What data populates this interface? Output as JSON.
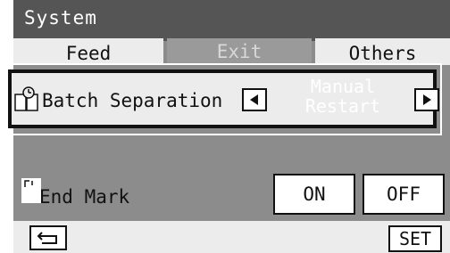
{
  "header": {
    "title": "System"
  },
  "tabs": [
    {
      "label": "Feed"
    },
    {
      "label": "Exit"
    },
    {
      "label": "Others"
    }
  ],
  "batch_separation": {
    "label": "Batch Separation",
    "mode_line1": "Manual",
    "mode_line2": "Restart"
  },
  "end_mark": {
    "label": "End Mark",
    "on_label": "ON",
    "off_label": "OFF"
  },
  "footer": {
    "set_label": "SET"
  },
  "colors": {
    "screen_bg": "#8c8c8c",
    "titlebar": "#555555",
    "panel": "#ececec",
    "border": "#111111"
  }
}
